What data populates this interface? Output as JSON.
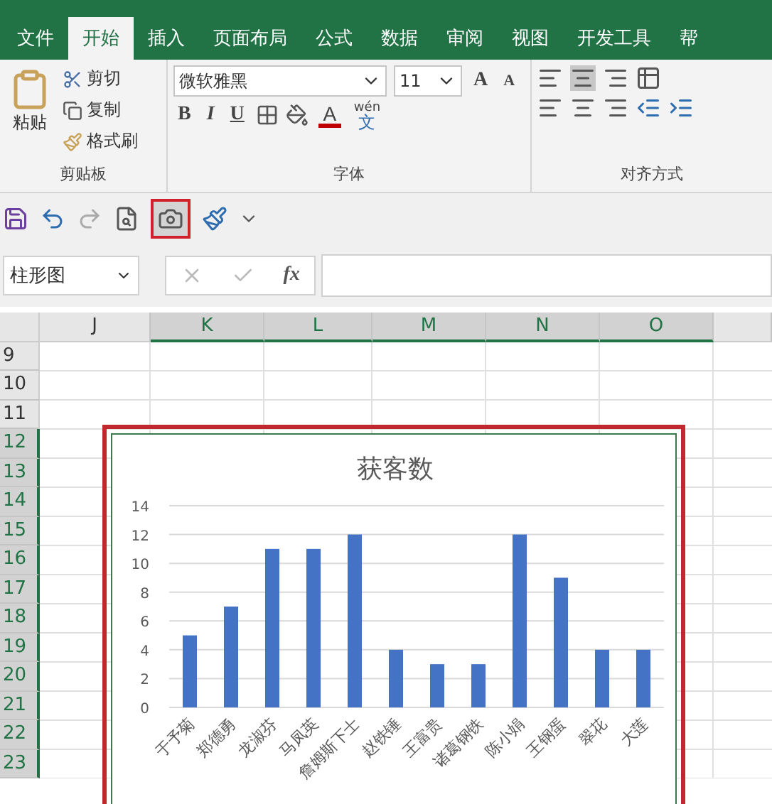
{
  "ribbon_tabs": [
    {
      "label": "文件",
      "selected": false
    },
    {
      "label": "开始",
      "selected": true
    },
    {
      "label": "插入",
      "selected": false
    },
    {
      "label": "页面布局",
      "selected": false
    },
    {
      "label": "公式",
      "selected": false
    },
    {
      "label": "数据",
      "selected": false
    },
    {
      "label": "审阅",
      "selected": false
    },
    {
      "label": "视图",
      "selected": false
    },
    {
      "label": "开发工具",
      "selected": false
    },
    {
      "label": "帮",
      "selected": false
    }
  ],
  "clipboard": {
    "paste": "粘贴",
    "cut": "剪切",
    "copy": "复制",
    "format_painter": "格式刷",
    "label": "剪贴板"
  },
  "font": {
    "name": "微软雅黑",
    "size": "11",
    "grow": "A",
    "shrink": "A",
    "bold": "B",
    "italic": "I",
    "underline": "U",
    "font_color": "A",
    "phonetic_top": "wén",
    "phonetic_bottom": "文",
    "label": "字体"
  },
  "alignment": {
    "label": "对齐方式"
  },
  "quick_access": {
    "camera_highlighted": true
  },
  "name_box": "柱形图",
  "formula_bar": {
    "function_label": "fx"
  },
  "columns": [
    {
      "label": "J",
      "selected": false
    },
    {
      "label": "K",
      "selected": true
    },
    {
      "label": "L",
      "selected": true
    },
    {
      "label": "M",
      "selected": true
    },
    {
      "label": "N",
      "selected": true
    },
    {
      "label": "O",
      "selected": true
    }
  ],
  "rows": [
    {
      "label": "9",
      "selected": false
    },
    {
      "label": "10",
      "selected": false
    },
    {
      "label": "11",
      "selected": false
    },
    {
      "label": "12",
      "selected": true
    },
    {
      "label": "13",
      "selected": true
    },
    {
      "label": "14",
      "selected": true
    },
    {
      "label": "15",
      "selected": true
    },
    {
      "label": "16",
      "selected": true
    },
    {
      "label": "17",
      "selected": true
    },
    {
      "label": "18",
      "selected": true
    },
    {
      "label": "19",
      "selected": true
    },
    {
      "label": "20",
      "selected": true
    },
    {
      "label": "21",
      "selected": true
    },
    {
      "label": "22",
      "selected": true
    },
    {
      "label": "23",
      "selected": true
    }
  ],
  "chart": {
    "highlighted": true,
    "chart_data": {
      "type": "bar",
      "title": "获客数",
      "categories": [
        "于予菊",
        "郑德勇",
        "龙淑芬",
        "马凤英",
        "詹姆斯下士",
        "赵铁锤",
        "王富贵",
        "诸葛钢铁",
        "陈小娟",
        "王钢蛋",
        "翠花",
        "大莲"
      ],
      "grid": true,
      "series": [
        {
          "color": "#4472c4",
          "values": [
            5,
            7,
            11,
            11,
            12,
            4,
            3,
            3,
            12,
            9,
            4,
            4
          ]
        }
      ],
      "ylim": [
        0,
        14
      ],
      "yticks": [
        0,
        2,
        4,
        6,
        8,
        10,
        12,
        14
      ]
    }
  }
}
